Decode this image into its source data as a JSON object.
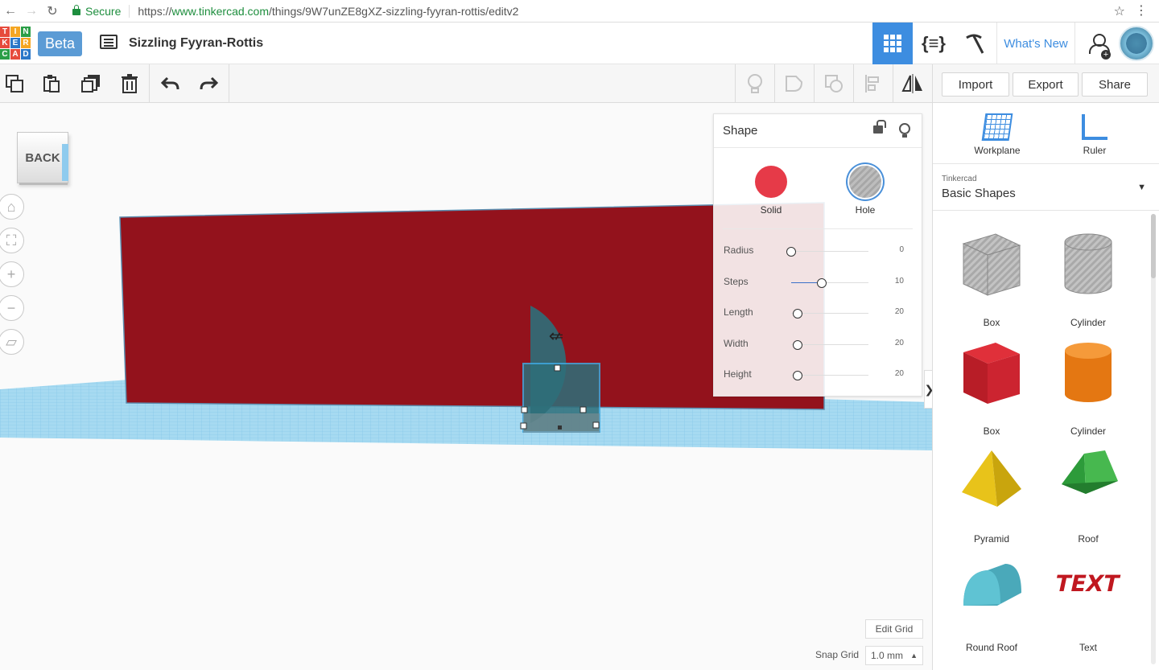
{
  "browser": {
    "secure_label": "Secure",
    "url_scheme": "https://",
    "url_host": "www.tinkercad.com",
    "url_path": "/things/9W7unZE8gXZ-sizzling-fyyran-rottis/editv2"
  },
  "header": {
    "logo_letters": [
      "T",
      "I",
      "N",
      "K",
      "E",
      "R",
      "C",
      "A",
      "D"
    ],
    "logo_colors": [
      "#e64b3c",
      "#f5a623",
      "#2b9e47",
      "#e64b3c",
      "#2b77c8",
      "#f5a623",
      "#2b9e47",
      "#e64b3c",
      "#2b77c8"
    ],
    "beta_label": "Beta",
    "project_title": "Sizzling Fyyran-Rottis",
    "code_glyph": "{≡}",
    "whats_new_label": "What's New"
  },
  "toolbar": {
    "import_label": "Import",
    "export_label": "Export",
    "share_label": "Share"
  },
  "viewport": {
    "viewcube_label": "BACK",
    "edit_grid_label": "Edit Grid",
    "snap_grid_label": "Snap Grid",
    "snap_grid_value": "1.0 mm",
    "colors": {
      "wall": "#93121c",
      "workplane": "#9fd8f0",
      "selection": "#3fa9e0",
      "hole_shape": "#2e6f7a"
    }
  },
  "inspector": {
    "title": "Shape",
    "solid_label": "Solid",
    "hole_label": "Hole",
    "params": [
      {
        "label": "Radius",
        "value": "0",
        "level": 0
      },
      {
        "label": "Steps",
        "value": "10",
        "level": 0.4
      },
      {
        "label": "Length",
        "value": "20",
        "level": 0.08
      },
      {
        "label": "Width",
        "value": "20",
        "level": 0.08
      },
      {
        "label": "Height",
        "value": "20",
        "level": 0.08
      }
    ]
  },
  "panel": {
    "workplane_label": "Workplane",
    "ruler_label": "Ruler",
    "category_small": "Tinkercad",
    "category_name": "Basic Shapes",
    "shapes": [
      {
        "label": "Box",
        "icon": "box-hole-icon"
      },
      {
        "label": "Cylinder",
        "icon": "cylinder-hole-icon"
      },
      {
        "label": "Box",
        "icon": "box-red-icon"
      },
      {
        "label": "Cylinder",
        "icon": "cylinder-orange-icon"
      },
      {
        "label": "Pyramid",
        "icon": "pyramid-icon"
      },
      {
        "label": "Roof",
        "icon": "roof-icon"
      },
      {
        "label": "Round Roof",
        "icon": "round-roof-icon"
      },
      {
        "label": "Text",
        "icon": "text-shape-icon"
      }
    ],
    "text_shape_glyph": "TEXT"
  }
}
